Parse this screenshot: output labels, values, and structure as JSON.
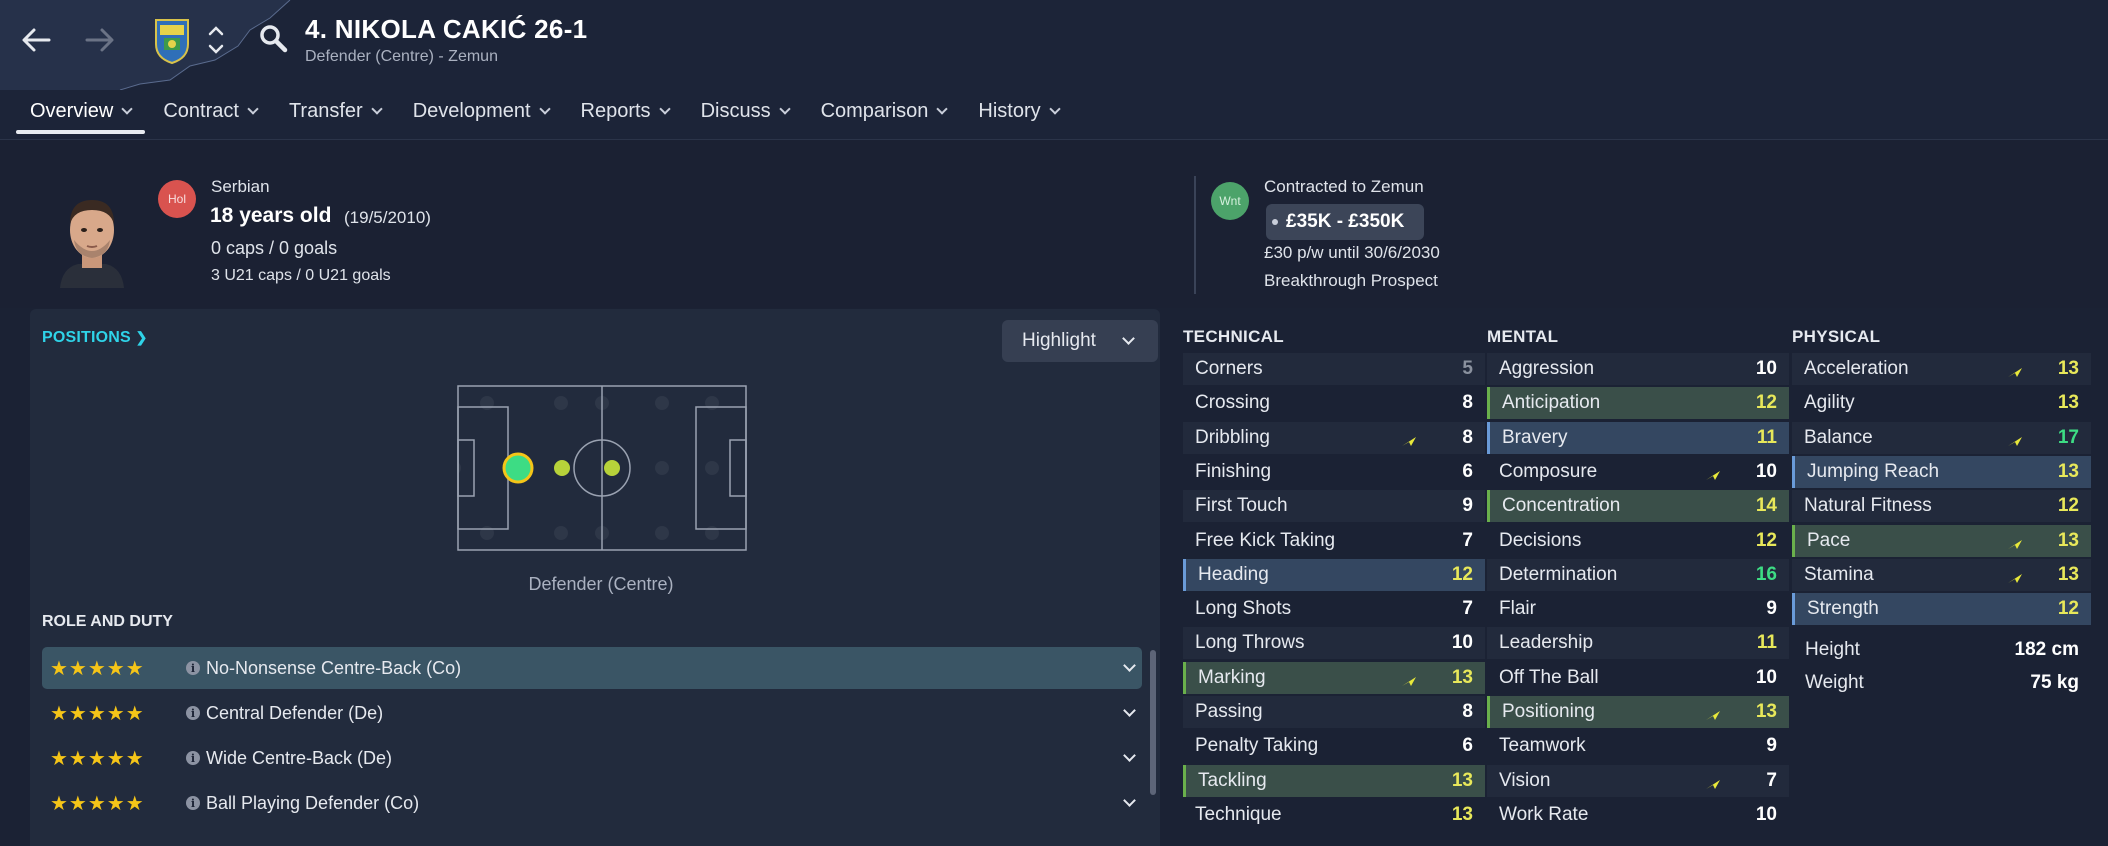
{
  "header": {
    "title": "4. NIKOLA CAKIĆ 26-1",
    "subtitle": "Defender (Centre) - Zemun"
  },
  "tabs": [
    {
      "label": "Overview"
    },
    {
      "label": "Contract"
    },
    {
      "label": "Transfer"
    },
    {
      "label": "Development"
    },
    {
      "label": "Reports"
    },
    {
      "label": "Discuss"
    },
    {
      "label": "Comparison"
    },
    {
      "label": "History"
    }
  ],
  "profile": {
    "nationality": "Serbian",
    "nation_badge": "Hol",
    "age": "18 years old",
    "dob": "(19/5/2010)",
    "caps": "0 caps / 0 goals",
    "u21": "3 U21 caps / 0 U21 goals",
    "status_badge": "Wnt",
    "contracted_to": "Contracted to Zemun",
    "value": "£35K - £350K",
    "wage": "£30 p/w until 30/6/2030",
    "tag": "Breakthrough Prospect"
  },
  "positions": {
    "link_label": "POSITIONS",
    "highlight_label": "Highlight",
    "pitch_label": "Defender (Centre)"
  },
  "roles": {
    "title": "ROLE AND DUTY",
    "items": [
      {
        "stars": 5,
        "name": "No-Nonsense Centre-Back (Co)"
      },
      {
        "stars": 5,
        "name": "Central Defender (De)"
      },
      {
        "stars": 5,
        "name": "Wide Centre-Back (De)"
      },
      {
        "stars": 5,
        "name": "Ball Playing Defender (Co)"
      }
    ]
  },
  "colors": {
    "value_white": "#ffffff",
    "value_yellow": "#e8e85a",
    "value_green": "#3ddc84",
    "value_grey": "#8a919e",
    "arrow_yellow": "#e8e83a",
    "accent_cyan": "#2fd3e8"
  },
  "technical": {
    "title": "TECHNICAL",
    "items": [
      {
        "name": "Corners",
        "value": "5"
      },
      {
        "name": "Crossing",
        "value": "8"
      },
      {
        "name": "Dribbling",
        "value": "8",
        "arrow": true
      },
      {
        "name": "Finishing",
        "value": "6"
      },
      {
        "name": "First Touch",
        "value": "9"
      },
      {
        "name": "Free Kick Taking",
        "value": "7"
      },
      {
        "name": "Heading",
        "value": "12",
        "hl": "blue"
      },
      {
        "name": "Long Shots",
        "value": "7"
      },
      {
        "name": "Long Throws",
        "value": "10"
      },
      {
        "name": "Marking",
        "value": "13",
        "hl": "green",
        "arrow": true
      },
      {
        "name": "Passing",
        "value": "8"
      },
      {
        "name": "Penalty Taking",
        "value": "6"
      },
      {
        "name": "Tackling",
        "value": "13",
        "hl": "green"
      },
      {
        "name": "Technique",
        "value": "13"
      }
    ]
  },
  "mental": {
    "title": "MENTAL",
    "items": [
      {
        "name": "Aggression",
        "value": "10"
      },
      {
        "name": "Anticipation",
        "value": "12",
        "hl": "green"
      },
      {
        "name": "Bravery",
        "value": "11",
        "hl": "blue"
      },
      {
        "name": "Composure",
        "value": "10",
        "arrow": true
      },
      {
        "name": "Concentration",
        "value": "14",
        "hl": "green"
      },
      {
        "name": "Decisions",
        "value": "12"
      },
      {
        "name": "Determination",
        "value": "16"
      },
      {
        "name": "Flair",
        "value": "9"
      },
      {
        "name": "Leadership",
        "value": "11"
      },
      {
        "name": "Off The Ball",
        "value": "10"
      },
      {
        "name": "Positioning",
        "value": "13",
        "hl": "green",
        "arrow": true
      },
      {
        "name": "Teamwork",
        "value": "9"
      },
      {
        "name": "Vision",
        "value": "7",
        "arrow": true
      },
      {
        "name": "Work Rate",
        "value": "10"
      }
    ]
  },
  "physical": {
    "title": "PHYSICAL",
    "items": [
      {
        "name": "Acceleration",
        "value": "13",
        "arrow": true
      },
      {
        "name": "Agility",
        "value": "13"
      },
      {
        "name": "Balance",
        "value": "17",
        "arrow": true
      },
      {
        "name": "Jumping Reach",
        "value": "13",
        "hl": "blue"
      },
      {
        "name": "Natural Fitness",
        "value": "12"
      },
      {
        "name": "Pace",
        "value": "13",
        "hl": "green",
        "arrow": true
      },
      {
        "name": "Stamina",
        "value": "13",
        "arrow": true
      },
      {
        "name": "Strength",
        "value": "12",
        "hl": "blue"
      }
    ],
    "height_label": "Height",
    "height_value": "182 cm",
    "weight_label": "Weight",
    "weight_value": "75 kg"
  }
}
